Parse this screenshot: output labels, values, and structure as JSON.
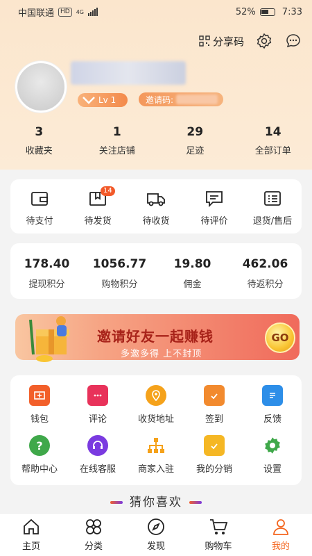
{
  "status_bar": {
    "carrier": "中国联通",
    "hd": "HD",
    "network": "4G",
    "battery": "52%",
    "time": "7:33"
  },
  "header": {
    "share_label": "分享码",
    "level_label": "Lv 1",
    "invite_label": "邀请码:"
  },
  "stats": [
    {
      "num": "3",
      "label": "收藏夹"
    },
    {
      "num": "1",
      "label": "关注店铺"
    },
    {
      "num": "29",
      "label": "足迹"
    },
    {
      "num": "14",
      "label": "全部订单"
    }
  ],
  "orders": [
    {
      "label": "待支付",
      "icon": "wallet-icon"
    },
    {
      "label": "待发货",
      "icon": "package-icon",
      "badge": "14"
    },
    {
      "label": "待收货",
      "icon": "truck-icon"
    },
    {
      "label": "待评价",
      "icon": "comment-icon"
    },
    {
      "label": "退货/售后",
      "icon": "list-icon"
    }
  ],
  "points": [
    {
      "num": "178.40",
      "label": "提现积分"
    },
    {
      "num": "1056.77",
      "label": "购物积分"
    },
    {
      "num": "19.80",
      "label": "佣金"
    },
    {
      "num": "462.06",
      "label": "待返积分"
    }
  ],
  "banner": {
    "title": "邀请好友一起赚钱",
    "subtitle": "多邀多得 上不封顶",
    "go": "GO"
  },
  "services": [
    {
      "label": "钱包",
      "icon": "wallet-icon",
      "color": "#f25f2a"
    },
    {
      "label": "评论",
      "icon": "chat-icon",
      "color": "#e8325a"
    },
    {
      "label": "收货地址",
      "icon": "location-icon",
      "color": "#f5a21b"
    },
    {
      "label": "签到",
      "icon": "calendar-icon",
      "color": "#f28a2e"
    },
    {
      "label": "反馈",
      "icon": "document-icon",
      "color": "#2d8ee8"
    },
    {
      "label": "帮助中心",
      "icon": "help-icon",
      "color": "#3fa84a"
    },
    {
      "label": "在线客服",
      "icon": "headset-icon",
      "color": "#7a3ae0"
    },
    {
      "label": "商家入驻",
      "icon": "org-icon",
      "color": "#f5a21b"
    },
    {
      "label": "我的分销",
      "icon": "calendar-check-icon",
      "color": "#f5b724"
    },
    {
      "label": "设置",
      "icon": "gear-icon",
      "color": "#3fa84a"
    }
  ],
  "guess_title": "猜你喜欢",
  "tabs": [
    {
      "label": "主页",
      "icon": "home-icon"
    },
    {
      "label": "分类",
      "icon": "category-icon"
    },
    {
      "label": "发现",
      "icon": "compass-icon"
    },
    {
      "label": "购物车",
      "icon": "cart-icon"
    },
    {
      "label": "我的",
      "icon": "user-icon",
      "active": true
    }
  ],
  "colors": {
    "accent": "#f4661f",
    "header_bg": "#fbe6cd",
    "banner_title": "#a8231a"
  }
}
